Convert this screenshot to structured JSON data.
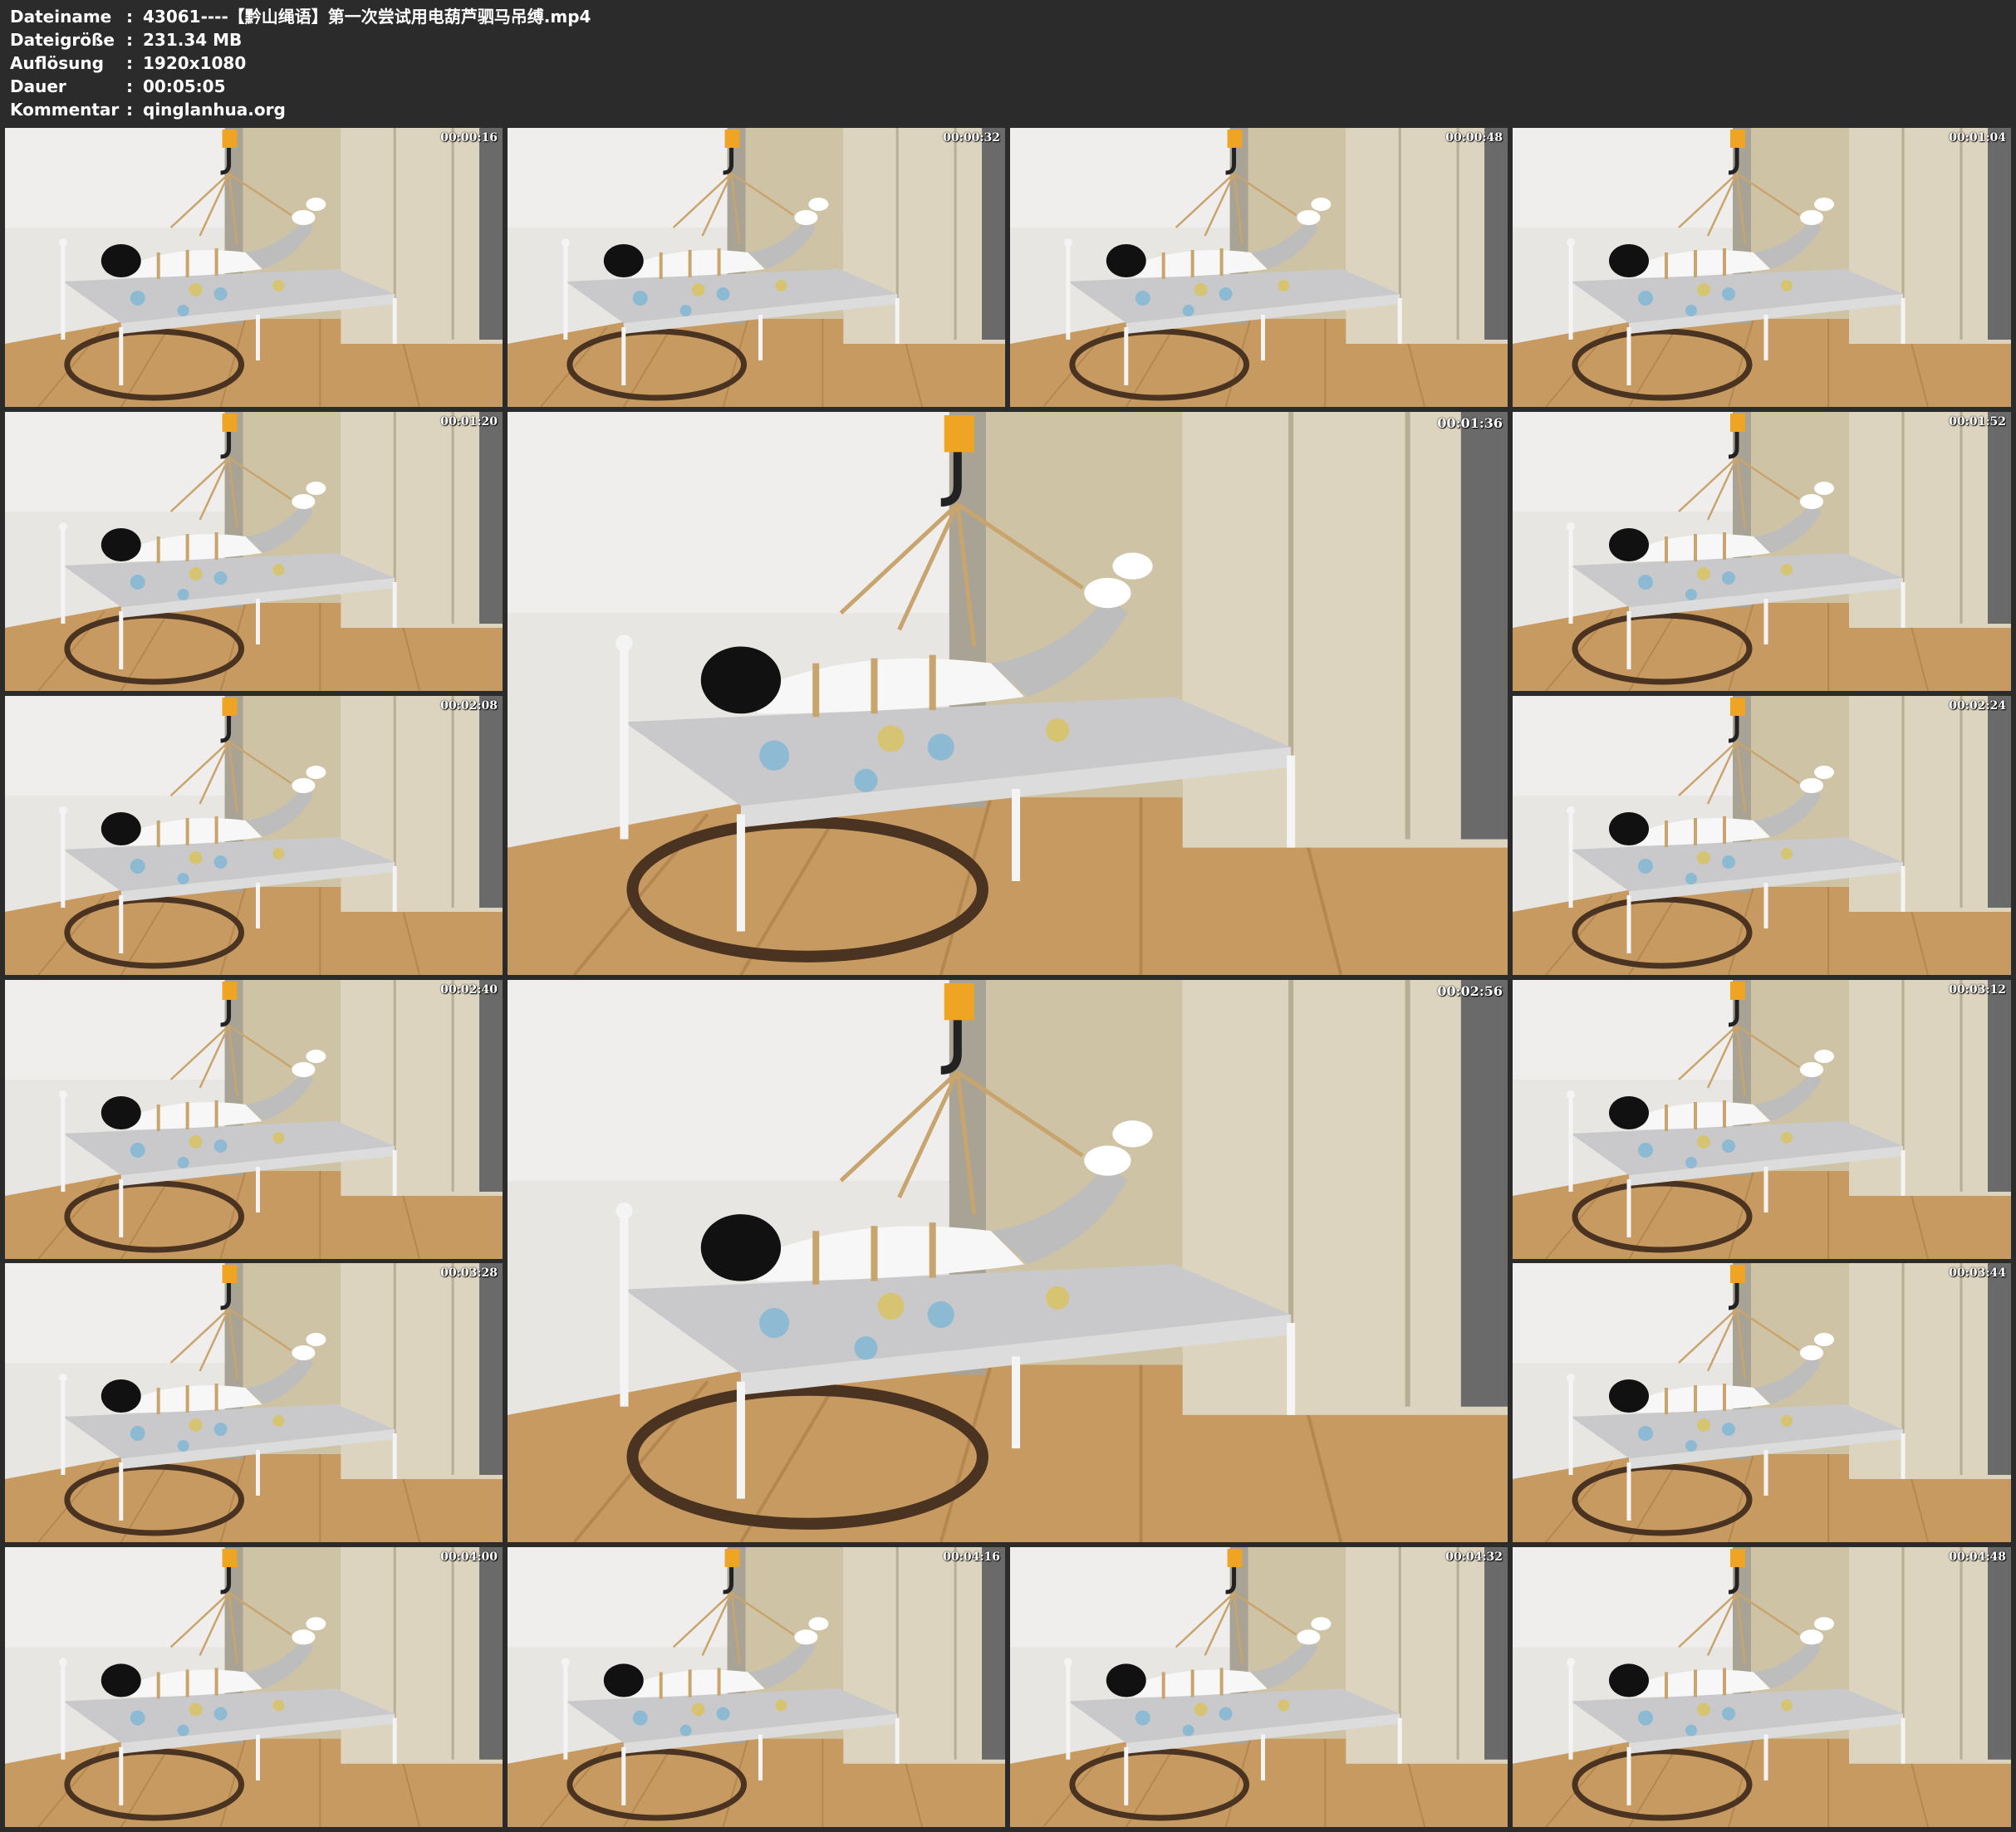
{
  "file_info": [
    {
      "key": "Dateiname",
      "value": "43061----【黔山绳语】第一次尝试用电葫芦驷马吊缚.mp4"
    },
    {
      "key": "Dateigröße",
      "value": "231.34 MB"
    },
    {
      "key": "Auflösung",
      "value": "1920x1080"
    },
    {
      "key": "Dauer",
      "value": "00:05:05"
    },
    {
      "key": "Kommentar",
      "value": "qinglanhua.org"
    }
  ],
  "separator": ":",
  "thumbnails": [
    "00:00:16",
    "00:00:32",
    "00:00:48",
    "00:01:04",
    "00:01:20",
    "00:01:36",
    "00:01:52",
    "00:02:08",
    "00:02:24",
    "00:02:40",
    "00:02:56",
    "00:03:12",
    "00:03:28",
    "00:03:44",
    "00:04:00",
    "00:04:16",
    "00:04:32",
    "00:04:48"
  ]
}
